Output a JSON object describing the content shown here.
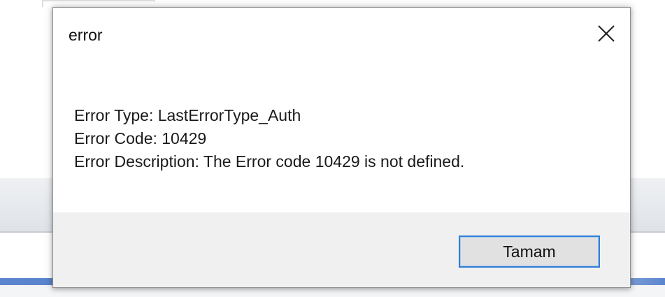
{
  "dialog": {
    "title": "error",
    "close_icon": "close-icon",
    "messages": {
      "type_line": "Error Type: LastErrorType_Auth",
      "code_line": "Error Code: 10429",
      "description_line": "Error Description: The Error code 10429 is not defined."
    },
    "ok_label": "Tamam"
  },
  "colors": {
    "accent": "#2f7fd6",
    "footer_background": "#f0f0f0",
    "button_background": "#e1e1e1"
  }
}
